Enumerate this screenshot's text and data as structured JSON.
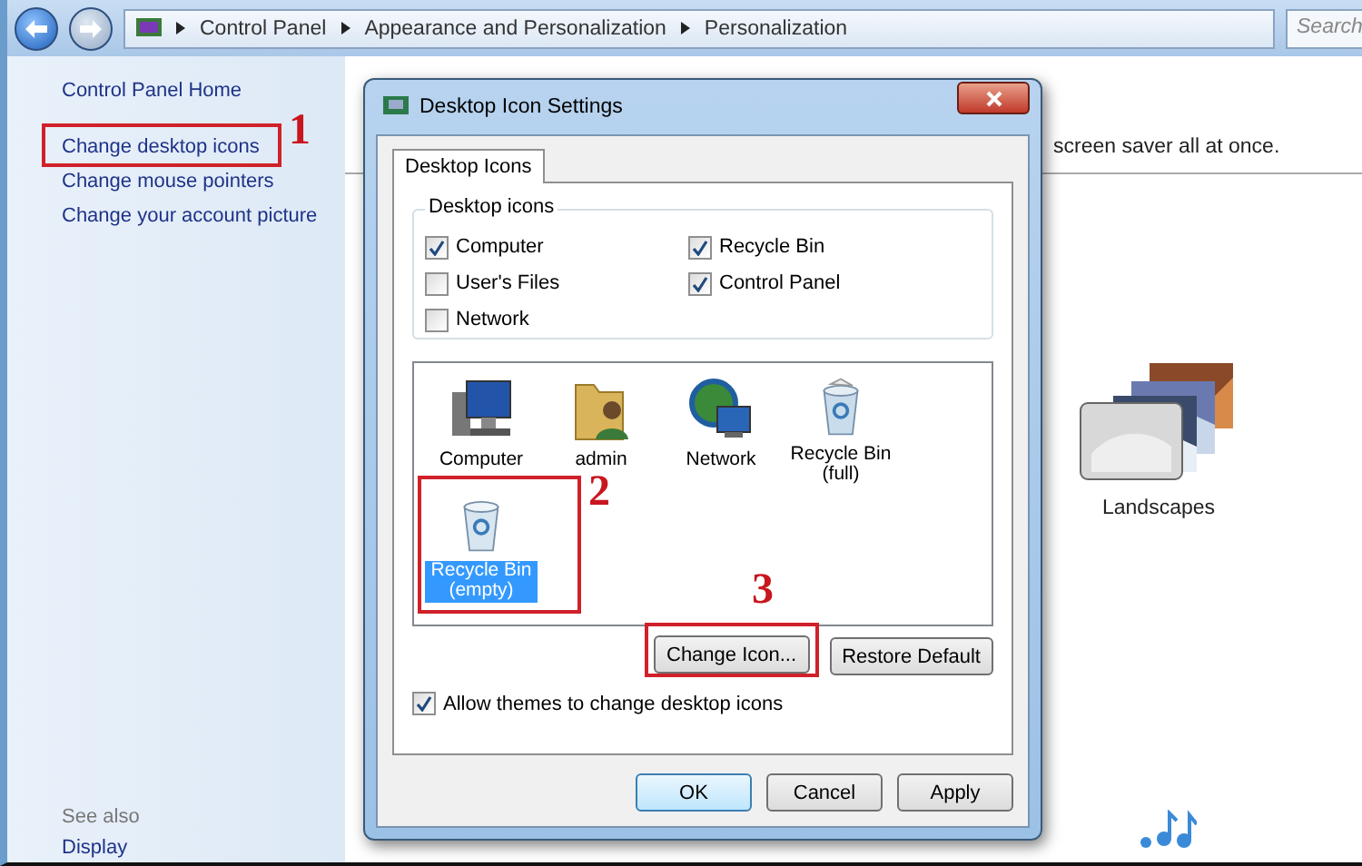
{
  "address_bar": {
    "breadcrumbs": [
      "Control Panel",
      "Appearance and Personalization",
      "Personalization"
    ]
  },
  "search": {
    "placeholder": "Search"
  },
  "sidebar": {
    "links": [
      {
        "label": "Control Panel Home"
      },
      {
        "label": "Change desktop icons"
      },
      {
        "label": "Change mouse pointers"
      },
      {
        "label": "Change your account picture"
      }
    ],
    "see_also": {
      "heading": "See also",
      "links": [
        "Display"
      ]
    }
  },
  "main": {
    "description": "screen saver all at once.",
    "themes": [
      {
        "label": "Landscapes"
      }
    ]
  },
  "dialog": {
    "title": "Desktop Icon Settings",
    "tabs": [
      {
        "label": "Desktop Icons",
        "selected": true
      }
    ],
    "group_label": "Desktop icons",
    "checkboxes": [
      {
        "label": "Computer",
        "checked": true
      },
      {
        "label": "User's Files",
        "checked": false
      },
      {
        "label": "Network",
        "checked": false
      },
      {
        "label": "Recycle Bin",
        "checked": true
      },
      {
        "label": "Control Panel",
        "checked": true
      }
    ],
    "icons": [
      {
        "label": "Computer",
        "kind": "computer",
        "selected": false
      },
      {
        "label": "admin",
        "kind": "user-folder",
        "selected": false
      },
      {
        "label": "Network",
        "kind": "network",
        "selected": false
      },
      {
        "label": "Recycle Bin (full)",
        "kind": "bin-full",
        "selected": false
      },
      {
        "label": "Recycle Bin (empty)",
        "kind": "bin-empty",
        "selected": true
      }
    ],
    "icon_buttons": [
      "Change Icon...",
      "Restore Default"
    ],
    "allow_themes": {
      "label": "Allow themes to change desktop icons",
      "checked": true
    },
    "buttons": [
      {
        "label": "OK",
        "default": true
      },
      {
        "label": "Cancel",
        "default": false
      },
      {
        "label": "Apply",
        "default": false
      }
    ]
  },
  "annotations": [
    {
      "label": "1"
    },
    {
      "label": "2"
    },
    {
      "label": "3"
    }
  ]
}
